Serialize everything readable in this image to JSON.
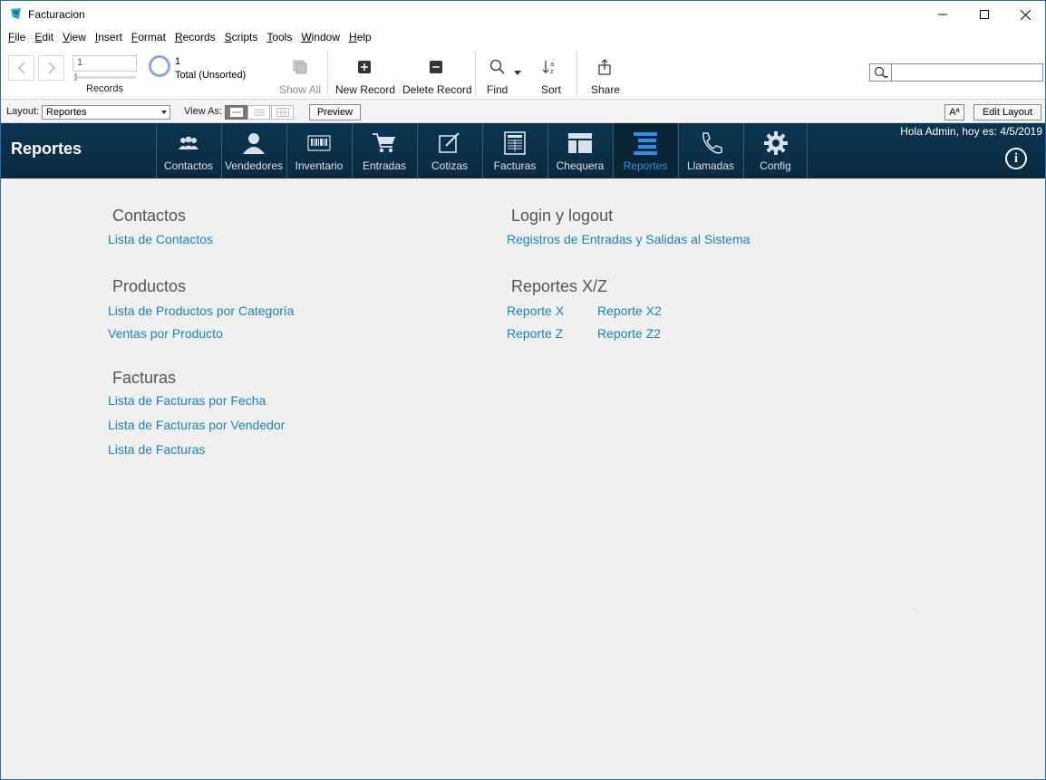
{
  "window": {
    "title": "Facturacion"
  },
  "menu": [
    "File",
    "Edit",
    "View",
    "Insert",
    "Format",
    "Records",
    "Scripts",
    "Tools",
    "Window",
    "Help"
  ],
  "toolbar": {
    "record_value": "1",
    "records_label": "Records",
    "found_count": "1",
    "found_total": "Total (Unsorted)",
    "show_all": "Show All",
    "new_record": "New Record",
    "delete_record": "Delete Record",
    "find": "Find",
    "sort": "Sort",
    "share": "Share",
    "search_value": ""
  },
  "layoutbar": {
    "layout_label": "Layout:",
    "layout_value": "Reportes",
    "view_as_label": "View As:",
    "preview": "Preview",
    "font_btn": "Aª",
    "edit_layout": "Edit Layout"
  },
  "header": {
    "title": "Reportes",
    "greeting": "Hola Admin, hoy es: 4/5/2019",
    "active_tab": "Reportes",
    "accent": "#2e8fe8",
    "tabs": [
      {
        "label": "Contactos",
        "icon": "contacts-icon"
      },
      {
        "label": "Vendedores",
        "icon": "person-icon"
      },
      {
        "label": "Inventario",
        "icon": "barcode-icon"
      },
      {
        "label": "Entradas",
        "icon": "cart-icon"
      },
      {
        "label": "Cotizas",
        "icon": "edit-icon"
      },
      {
        "label": "Facturas",
        "icon": "invoice-icon"
      },
      {
        "label": "Chequera",
        "icon": "layout-icon"
      },
      {
        "label": "Reportes",
        "icon": "reports-icon"
      },
      {
        "label": "Llamadas",
        "icon": "phone-icon"
      },
      {
        "label": "Config",
        "icon": "gear-icon"
      }
    ]
  },
  "sections": {
    "contactos": {
      "title": "Contactos",
      "links": [
        "Lista de Contactos"
      ]
    },
    "productos": {
      "title": "Productos",
      "links": [
        "Lista de Productos por Categoría",
        "Ventas por Producto"
      ]
    },
    "facturas": {
      "title": "Facturas",
      "links": [
        "Lista de Facturas por Fecha",
        "Lista de Facturas por Vendedor",
        "Lista de Facturas"
      ]
    },
    "login": {
      "title": "Login y logout",
      "links": [
        "Registros de Entradas y Salidas al Sistema"
      ]
    },
    "xz": {
      "title": "Reportes X/Z",
      "links": [
        "Reporte X",
        "Reporte X2",
        "Reporte Z",
        "Reporte Z2"
      ]
    }
  }
}
